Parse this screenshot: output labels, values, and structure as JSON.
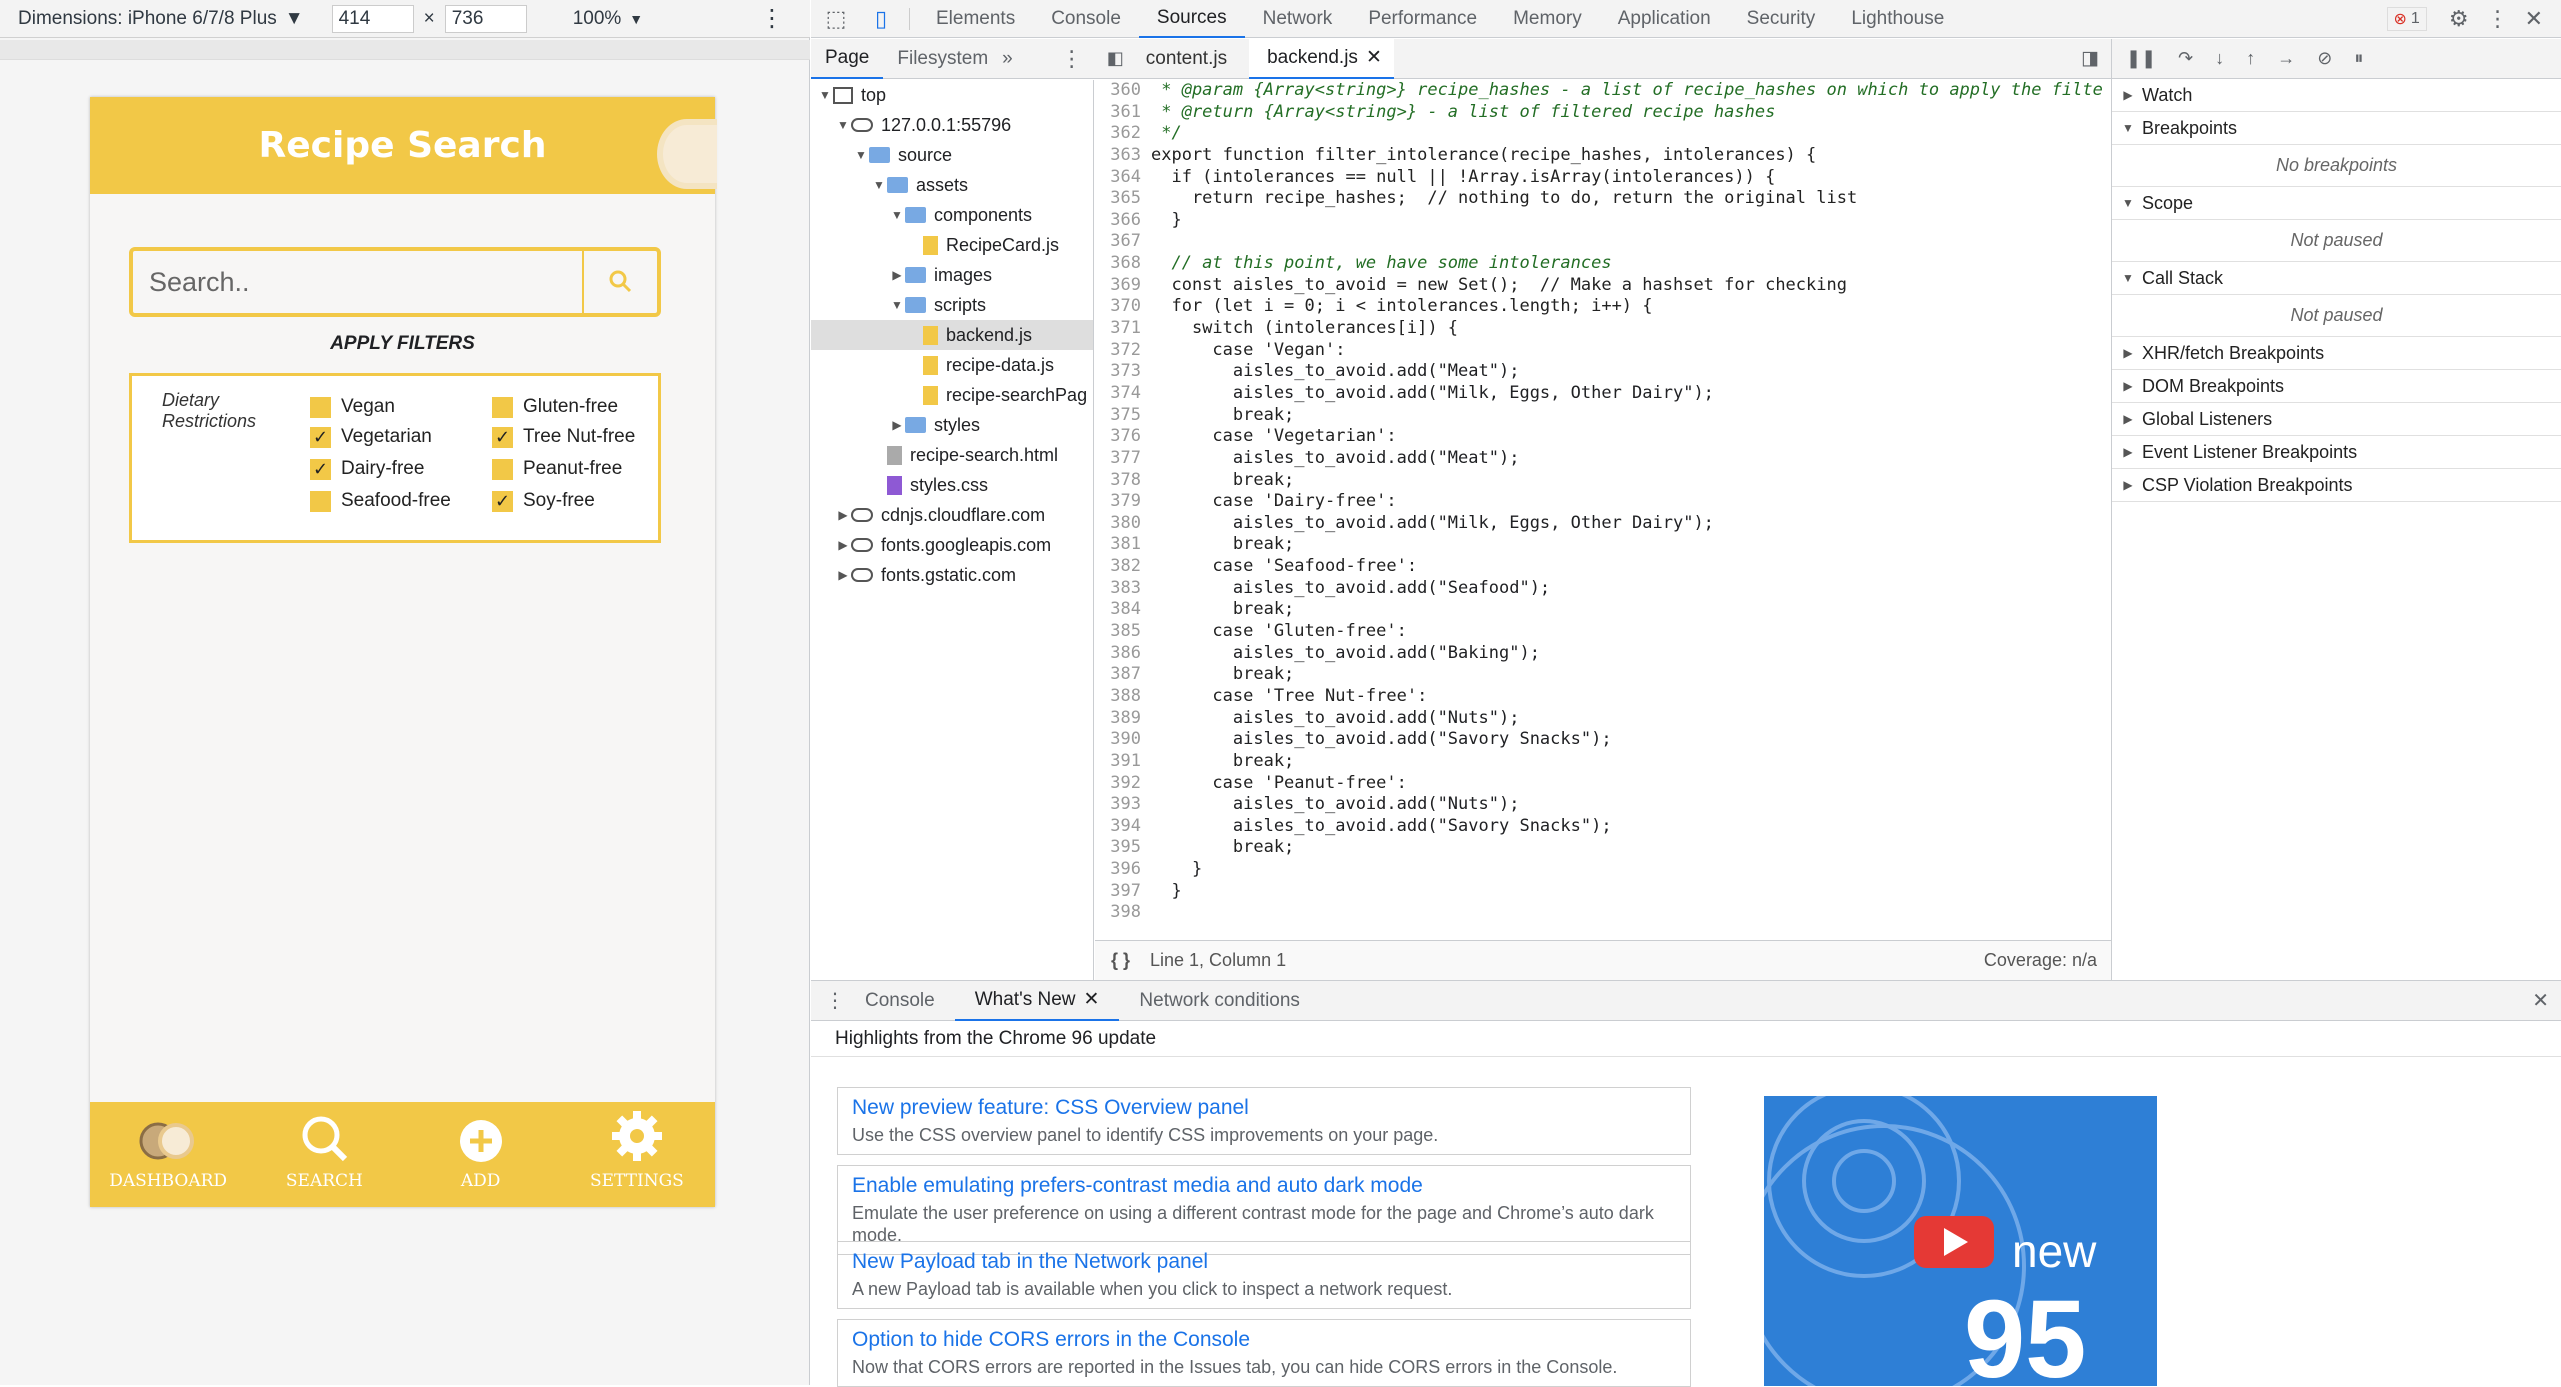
{
  "device_toolbar": {
    "dimensions_label": "Dimensions: iPhone 6/7/8 Plus",
    "width": "414",
    "times": "×",
    "height": "736",
    "zoom": "100%"
  },
  "app": {
    "title": "Recipe Search",
    "search_placeholder": "Search..",
    "apply_filters": "APPLY FILTERS",
    "dietary_label_1": "Dietary",
    "dietary_label_2": "Restrictions",
    "filters": [
      {
        "label": "Vegan",
        "checked": false
      },
      {
        "label": "Gluten-free",
        "checked": false
      },
      {
        "label": "Vegetarian",
        "checked": true
      },
      {
        "label": "Tree Nut-free",
        "checked": true
      },
      {
        "label": "Dairy-free",
        "checked": true
      },
      {
        "label": "Peanut-free",
        "checked": false
      },
      {
        "label": "Seafood-free",
        "checked": false
      },
      {
        "label": "Soy-free",
        "checked": true
      }
    ],
    "footer": [
      "DASHBOARD",
      "SEARCH",
      "ADD",
      "SETTINGS"
    ]
  },
  "devtools": {
    "tabs": [
      "Elements",
      "Console",
      "Sources",
      "Network",
      "Performance",
      "Memory",
      "Application",
      "Security",
      "Lighthouse"
    ],
    "active_tab": "Sources",
    "error_count": "1",
    "nav_tabs": [
      "Page",
      "Filesystem"
    ],
    "file_tabs": [
      "content.js",
      "backend.js"
    ],
    "tree": [
      {
        "label": "top",
        "depth": 0,
        "kind": "page",
        "open": true
      },
      {
        "label": "127.0.0.1:55796",
        "depth": 1,
        "kind": "cloud",
        "open": true
      },
      {
        "label": "source",
        "depth": 2,
        "kind": "folder",
        "open": true
      },
      {
        "label": "assets",
        "depth": 3,
        "kind": "folder",
        "open": true
      },
      {
        "label": "components",
        "depth": 4,
        "kind": "folder",
        "open": true
      },
      {
        "label": "RecipeCard.js",
        "depth": 5,
        "kind": "file"
      },
      {
        "label": "images",
        "depth": 4,
        "kind": "folder",
        "open": false
      },
      {
        "label": "scripts",
        "depth": 4,
        "kind": "folder",
        "open": true
      },
      {
        "label": "backend.js",
        "depth": 5,
        "kind": "file",
        "selected": true
      },
      {
        "label": "recipe-data.js",
        "depth": 5,
        "kind": "file"
      },
      {
        "label": "recipe-searchPag",
        "depth": 5,
        "kind": "file"
      },
      {
        "label": "styles",
        "depth": 4,
        "kind": "folder",
        "open": false
      },
      {
        "label": "recipe-search.html",
        "depth": 3,
        "kind": "html"
      },
      {
        "label": "styles.css",
        "depth": 3,
        "kind": "css"
      },
      {
        "label": "cdnjs.cloudflare.com",
        "depth": 1,
        "kind": "cloud",
        "open": false
      },
      {
        "label": "fonts.googleapis.com",
        "depth": 1,
        "kind": "cloud",
        "open": false
      },
      {
        "label": "fonts.gstatic.com",
        "depth": 1,
        "kind": "cloud",
        "open": false
      }
    ],
    "code": [
      [
        "360",
        "cm",
        " * @param {Array<string>} recipe_hashes - a list of recipe_hashes on which to apply the filte"
      ],
      [
        "361",
        "cm",
        " * @return {Array<string>} - a list of filtered recipe hashes"
      ],
      [
        "362",
        "cm",
        " */"
      ],
      [
        "363",
        "plain",
        "export function filter_intolerance(recipe_hashes, intolerances) {"
      ],
      [
        "364",
        "plain",
        "  if (intolerances == null || !Array.isArray(intolerances)) {"
      ],
      [
        "365",
        "plain",
        "    return recipe_hashes;  // nothing to do, return the original list"
      ],
      [
        "366",
        "plain",
        "  }"
      ],
      [
        "367",
        "plain",
        ""
      ],
      [
        "368",
        "cm",
        "  // at this point, we have some intolerances"
      ],
      [
        "369",
        "plain",
        "  const aisles_to_avoid = new Set();  // Make a hashset for checking"
      ],
      [
        "370",
        "plain",
        "  for (let i = 0; i < intolerances.length; i++) {"
      ],
      [
        "371",
        "plain",
        "    switch (intolerances[i]) {"
      ],
      [
        "372",
        "plain",
        "      case 'Vegan':"
      ],
      [
        "373",
        "plain",
        "        aisles_to_avoid.add(\"Meat\");"
      ],
      [
        "374",
        "plain",
        "        aisles_to_avoid.add(\"Milk, Eggs, Other Dairy\");"
      ],
      [
        "375",
        "plain",
        "        break;"
      ],
      [
        "376",
        "plain",
        "      case 'Vegetarian':"
      ],
      [
        "377",
        "plain",
        "        aisles_to_avoid.add(\"Meat\");"
      ],
      [
        "378",
        "plain",
        "        break;"
      ],
      [
        "379",
        "plain",
        "      case 'Dairy-free':"
      ],
      [
        "380",
        "plain",
        "        aisles_to_avoid.add(\"Milk, Eggs, Other Dairy\");"
      ],
      [
        "381",
        "plain",
        "        break;"
      ],
      [
        "382",
        "plain",
        "      case 'Seafood-free':"
      ],
      [
        "383",
        "plain",
        "        aisles_to_avoid.add(\"Seafood\");"
      ],
      [
        "384",
        "plain",
        "        break;"
      ],
      [
        "385",
        "plain",
        "      case 'Gluten-free':"
      ],
      [
        "386",
        "plain",
        "        aisles_to_avoid.add(\"Baking\");"
      ],
      [
        "387",
        "plain",
        "        break;"
      ],
      [
        "388",
        "plain",
        "      case 'Tree Nut-free':"
      ],
      [
        "389",
        "plain",
        "        aisles_to_avoid.add(\"Nuts\");"
      ],
      [
        "390",
        "plain",
        "        aisles_to_avoid.add(\"Savory Snacks\");"
      ],
      [
        "391",
        "plain",
        "        break;"
      ],
      [
        "392",
        "plain",
        "      case 'Peanut-free':"
      ],
      [
        "393",
        "plain",
        "        aisles_to_avoid.add(\"Nuts\");"
      ],
      [
        "394",
        "plain",
        "        aisles_to_avoid.add(\"Savory Snacks\");"
      ],
      [
        "395",
        "plain",
        "        break;"
      ],
      [
        "396",
        "plain",
        "    }"
      ],
      [
        "397",
        "plain",
        "  }"
      ],
      [
        "398",
        "plain",
        ""
      ]
    ],
    "status": "Line 1, Column 1",
    "coverage": "Coverage: n/a",
    "debugger": {
      "watch": "Watch",
      "breakpoints": "Breakpoints",
      "no_breakpoints": "No breakpoints",
      "scope": "Scope",
      "not_paused": "Not paused",
      "call_stack": "Call Stack",
      "others": [
        "XHR/fetch Breakpoints",
        "DOM Breakpoints",
        "Global Listeners",
        "Event Listener Breakpoints",
        "CSP Violation Breakpoints"
      ]
    },
    "drawer": {
      "tabs": [
        "Console",
        "What's New",
        "Network conditions"
      ],
      "highlights": "Highlights from the Chrome 96 update",
      "cards": [
        {
          "title": "New preview feature: CSS Overview panel",
          "desc": "Use the CSS overview panel to identify CSS improvements on your page."
        },
        {
          "title": "Enable emulating prefers-contrast media and auto dark mode",
          "desc": "Emulate the user preference on using a different contrast mode for the page and Chrome’s auto dark mode."
        },
        {
          "title": "New Payload tab in the Network panel",
          "desc": "A new Payload tab is available when you click to inspect a network request."
        },
        {
          "title": "Option to hide CORS errors in the Console",
          "desc": "Now that CORS errors are reported in the Issues tab, you can hide CORS errors in the Console."
        }
      ],
      "video_text_1": "new",
      "video_text_2": "95"
    }
  }
}
